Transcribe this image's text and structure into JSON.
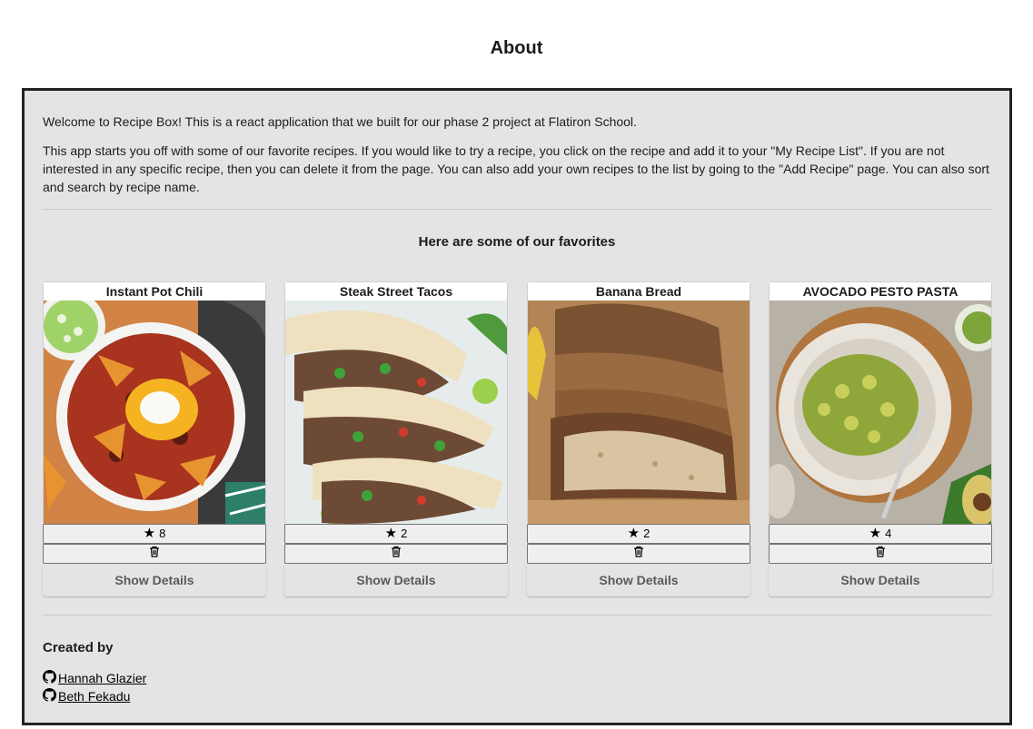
{
  "page": {
    "title": "About"
  },
  "about": {
    "intro_1": "Welcome to Recipe Box! This is a react application that we built for our phase 2 project at Flatiron School.",
    "intro_2": "This app starts you off with some of our favorite recipes. If you would like to try a recipe, you click on the recipe and add it to your \"My Recipe List\". If you are not interested in any specific recipe, then you can delete it from the page. You can also add your own recipes to the list by going to the \"Add Recipe\" page. You can also sort and search by recipe name.",
    "favorites_heading": "Here are some of our favorites"
  },
  "recipes": [
    {
      "name": "Instant Pot Chili",
      "likes": "8",
      "details_label": "Show Details",
      "image": "chili"
    },
    {
      "name": "Steak Street Tacos",
      "likes": "2",
      "details_label": "Show Details",
      "image": "tacos"
    },
    {
      "name": "Banana Bread",
      "likes": "2",
      "details_label": "Show Details",
      "image": "bread"
    },
    {
      "name": "AVOCADO PESTO PASTA",
      "likes": "4",
      "details_label": "Show Details",
      "image": "pasta"
    }
  ],
  "icons": {
    "like": "star-icon",
    "delete": "trash-icon",
    "author": "github-icon"
  },
  "credits": {
    "heading": "Created by",
    "authors": [
      {
        "name": " Hannah Glazier"
      },
      {
        "name": " Beth Fekadu"
      }
    ]
  }
}
